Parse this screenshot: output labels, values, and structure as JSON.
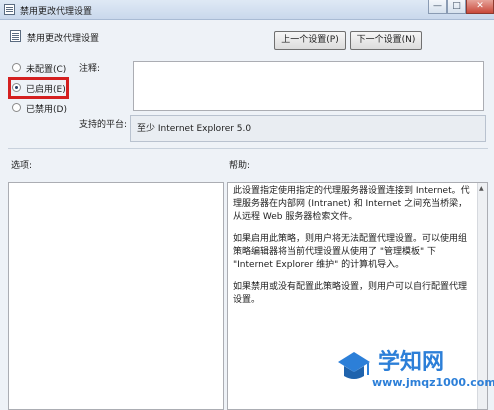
{
  "window": {
    "title": "禁用更改代理设置",
    "min_label": "—",
    "max_label": "□",
    "close_label": "✕"
  },
  "header": {
    "title": "禁用更改代理设置",
    "prev_button": "上一个设置(P)",
    "next_button": "下一个设置(N)"
  },
  "radios": {
    "not_configured": "未配置(C)",
    "enabled": "已启用(E)",
    "disabled": "已禁用(D)",
    "selected": "enabled"
  },
  "labels": {
    "comment": "注释:",
    "platform": "支持的平台:",
    "options": "选项:",
    "help": "帮助:"
  },
  "comment_value": "",
  "platform_value": "至少 Internet Explorer 5.0",
  "help_text": [
    "此设置指定使用指定的代理服务器设置连接到 Internet。代理服务器在内部网 (Intranet) 和 Internet 之间充当桥梁，从远程 Web 服务器检索文件。",
    "如果启用此策略，则用户将无法配置代理设置。可以使用组策略编辑器将当前代理设置从使用了 \"管理模板\" 下 \"Internet Explorer 维护\" 的计算机导入。",
    "如果禁用或没有配置此策略设置，则用户可以自行配置代理设置。"
  ],
  "watermark": {
    "title": "学知网",
    "url": "www.jmqz1000.com"
  },
  "colors": {
    "highlight": "#d42020",
    "watermark": "#2c7fd8"
  }
}
